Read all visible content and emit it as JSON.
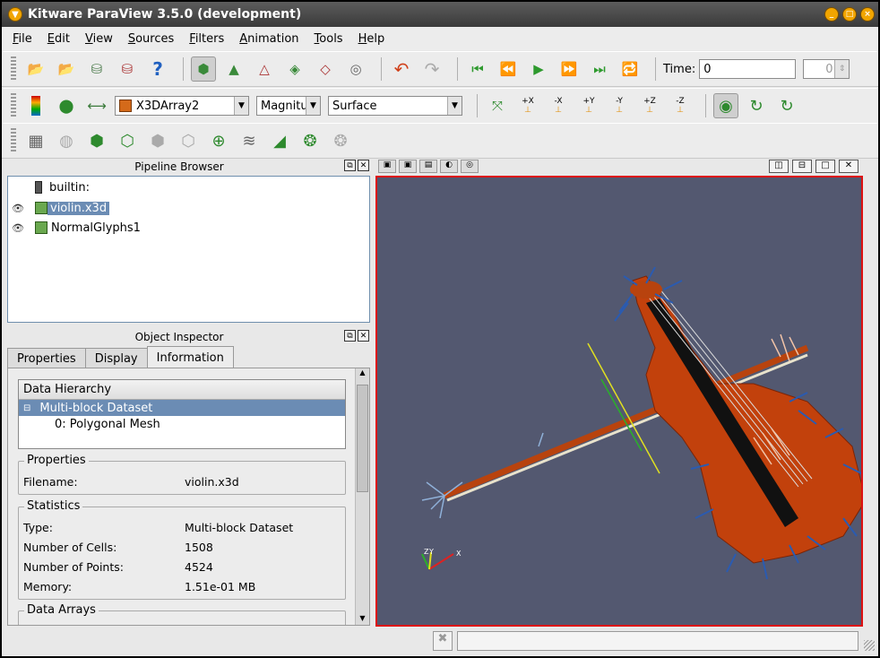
{
  "window": {
    "title": "Kitware ParaView 3.5.0 (development)"
  },
  "menu": [
    "File",
    "Edit",
    "View",
    "Sources",
    "Filters",
    "Animation",
    "Tools",
    "Help"
  ],
  "time": {
    "label": "Time:",
    "value": "0",
    "index": "0"
  },
  "combos": {
    "array": "X3DArray2",
    "component": "Magnitu",
    "representation": "Surface"
  },
  "camera_labels": [
    "+X",
    "-X",
    "+Y",
    "-Y",
    "+Z",
    "-Z"
  ],
  "pipeline": {
    "title": "Pipeline Browser",
    "items": [
      "builtin:",
      "violin.x3d",
      "NormalGlyphs1"
    ]
  },
  "inspector": {
    "title": "Object Inspector",
    "tabs": [
      "Properties",
      "Display",
      "Information"
    ]
  },
  "information": {
    "data_hierarchy_header": "Data Hierarchy",
    "root": "Multi-block Dataset",
    "child": "0: Polygonal Mesh",
    "properties_title": "Properties",
    "filename_label": "Filename:",
    "filename_value": "violin.x3d",
    "statistics_title": "Statistics",
    "stats": [
      {
        "label": "Type:",
        "value": "Multi-block Dataset"
      },
      {
        "label": "Number of Cells:",
        "value": "1508"
      },
      {
        "label": "Number of Points:",
        "value": "4524"
      },
      {
        "label": "Memory:",
        "value": "1.51e-01 MB"
      }
    ],
    "data_arrays_title": "Data Arrays"
  },
  "axes": {
    "y": "Y",
    "z": "Z",
    "x": "X"
  },
  "colors": {
    "viewport_bg": "#535870",
    "active_border": "#dd1111",
    "selection": "#6b8cb4",
    "violin": "#c2410c",
    "glyph_blue": "#2b5bb0"
  }
}
